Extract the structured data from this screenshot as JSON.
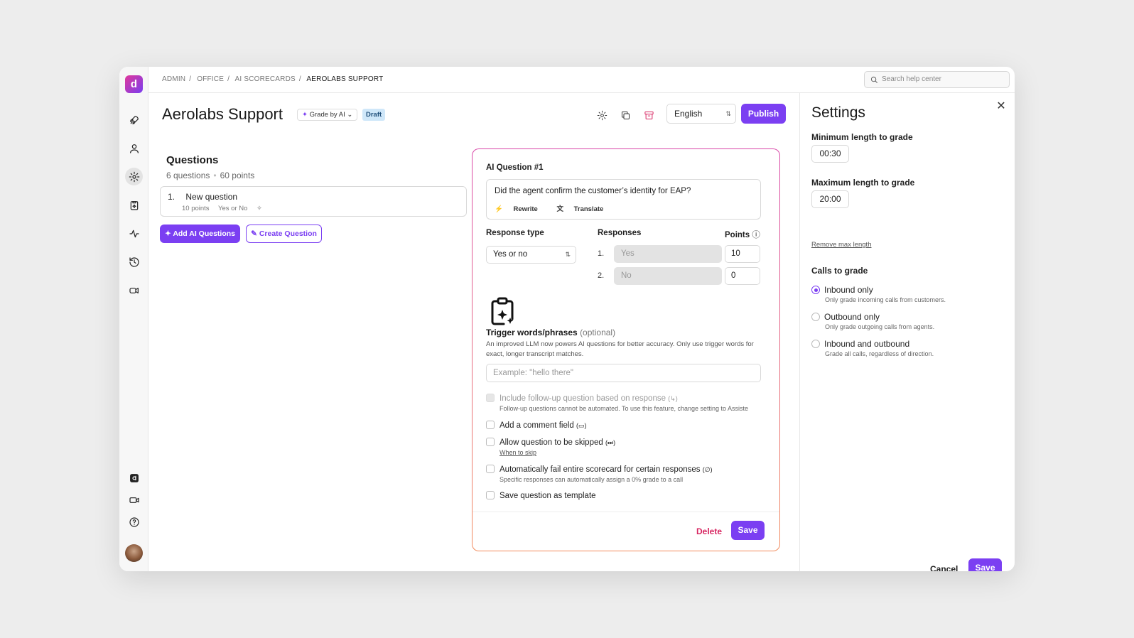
{
  "app": {
    "logo_letter": "d",
    "accent_color": "#7b3ff2"
  },
  "breadcrumb": {
    "items": [
      "ADMIN",
      "OFFICE",
      "AI SCORECARDS"
    ],
    "current": "AEROLABS SUPPORT"
  },
  "search": {
    "placeholder": "Search help center"
  },
  "header": {
    "title": "Aerolabs Support",
    "grade_chip": "Grade by AI",
    "status_badge": "Draft",
    "language": "English",
    "publish_label": "Publish"
  },
  "questions": {
    "heading": "Questions",
    "count": "6 questions",
    "points": "60 points",
    "items": [
      {
        "num": "1.",
        "title": "New question",
        "points": "10 points",
        "type": "Yes or No"
      }
    ],
    "add_ai_label": "Add AI Questions",
    "create_label": "Create Question"
  },
  "editor": {
    "heading": "AI Question #1",
    "question_text": "Did the agent confirm the customer’s identity for EAP?",
    "rewrite_label": "Rewrite",
    "translate_label": "Translate",
    "response_type_label": "Response type",
    "response_type_value": "Yes or no",
    "responses_label": "Responses",
    "points_label": "Points",
    "responses": [
      {
        "num": "1.",
        "value": "Yes",
        "points": "10"
      },
      {
        "num": "2.",
        "value": "No",
        "points": "0"
      }
    ],
    "trigger_title": "Trigger words/phrases",
    "trigger_optional": "(optional)",
    "trigger_desc": "An improved LLM now powers AI questions for better accuracy. Only use trigger words for exact, longer transcript matches.",
    "trigger_placeholder": "Example: \"hello there\"",
    "options": {
      "followup": "Include follow-up question based on response",
      "followup_sub": "Follow-up questions cannot be automated. To use this feature, change setting to Assiste",
      "comment": "Add a comment field",
      "skip": "Allow question to be skipped",
      "skip_link": "When to skip",
      "autofail": "Automatically fail entire scorecard for certain responses",
      "autofail_sub": "Specific responses can automatically assign a 0% grade to a call",
      "template": "Save question as template"
    },
    "delete_label": "Delete",
    "save_label": "Save"
  },
  "settings": {
    "title": "Settings",
    "min_label": "Minimum length to grade",
    "min_value": "00:30",
    "max_label": "Maximum length to grade",
    "max_value": "20:00",
    "remove_max": "Remove max length",
    "calls_label": "Calls to grade",
    "radios": [
      {
        "label": "Inbound only",
        "sub": "Only grade incoming calls from customers.",
        "selected": true
      },
      {
        "label": "Outbound only",
        "sub": "Only grade outgoing calls from agents.",
        "selected": false
      },
      {
        "label": "Inbound and outbound",
        "sub": "Grade all calls, regardless of direction.",
        "selected": false
      }
    ],
    "cancel_label": "Cancel",
    "save_label": "Save"
  }
}
